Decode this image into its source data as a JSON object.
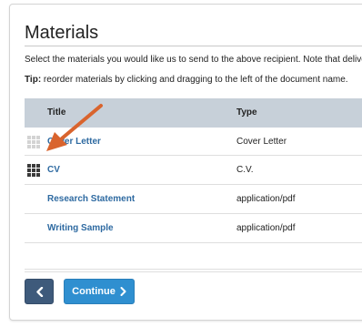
{
  "colors": {
    "link": "#2e6aa1",
    "table_header_bg": "#c7d0d9",
    "back_button": "#3e5a7b",
    "continue_button": "#2f8fd0",
    "annotation_arrow": "#d9642e"
  },
  "section": {
    "title": "Materials",
    "description": "Select the materials you would like us to send to the above recipient. Note that delivery of",
    "tip_label": "Tip:",
    "tip_text": " reorder materials by clicking and dragging to the left of the document name."
  },
  "table": {
    "columns": [
      "Title",
      "Type"
    ],
    "rows": [
      {
        "title": "Cover Letter",
        "type": "Cover Letter",
        "grip": "light-grip-icon"
      },
      {
        "title": "CV",
        "type": "C.V.",
        "grip": "dark-grip-icon"
      },
      {
        "title": "Research Statement",
        "type": "application/pdf",
        "grip": null
      },
      {
        "title": "Writing Sample",
        "type": "application/pdf",
        "grip": null
      }
    ]
  },
  "buttons": {
    "back_icon": "chevron-left-icon",
    "continue_label": "Continue",
    "continue_icon": "chevron-right-icon"
  },
  "annotation": {
    "icon": "arrow-pointer-icon"
  }
}
